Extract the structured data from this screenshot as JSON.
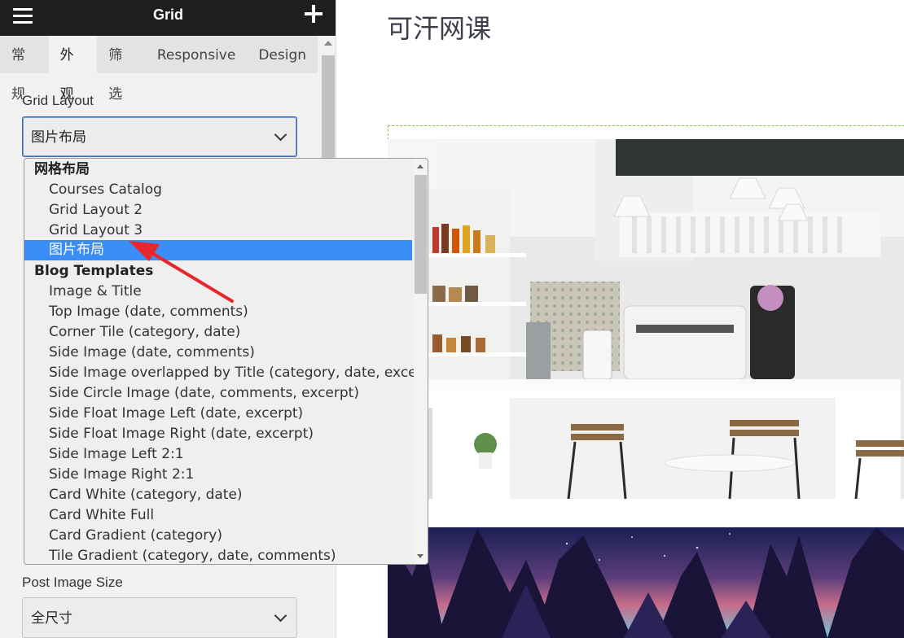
{
  "panel": {
    "title": "Grid",
    "tabs": [
      {
        "label": "常规"
      },
      {
        "label": "外观"
      },
      {
        "label": "筛选"
      },
      {
        "label": "Responsive"
      },
      {
        "label": "Design"
      }
    ],
    "active_tab": 1
  },
  "grid_layout": {
    "label": "Grid Layout",
    "value": "图片布局"
  },
  "dropdown": {
    "options": [
      {
        "label": "网格布局",
        "group": true
      },
      {
        "label": "Courses Catalog"
      },
      {
        "label": "Grid Layout 2"
      },
      {
        "label": "Grid Layout 3"
      },
      {
        "label": "图片布局",
        "selected": true
      },
      {
        "label": "Blog Templates",
        "group": true
      },
      {
        "label": "Image & Title"
      },
      {
        "label": "Top Image (date, comments)"
      },
      {
        "label": "Corner Tile (category, date)"
      },
      {
        "label": "Side Image (date, comments)"
      },
      {
        "label": "Side Image overlapped by Title (category, date, excerpt)"
      },
      {
        "label": "Side Circle Image (date, comments, excerpt)"
      },
      {
        "label": "Side Float Image Left (date, excerpt)"
      },
      {
        "label": "Side Float Image Right (date, excerpt)"
      },
      {
        "label": "Side Image Left 2:1"
      },
      {
        "label": "Side Image Right 2:1"
      },
      {
        "label": "Card White (category, date)"
      },
      {
        "label": "Card White Full"
      },
      {
        "label": "Card Gradient (category)"
      },
      {
        "label": "Tile Gradient (category, date, comments)"
      }
    ]
  },
  "post_image_size": {
    "label": "Post Image Size",
    "value": "全尺寸"
  },
  "site": {
    "title": "可汗网课"
  },
  "colors": {
    "selected_option": "#3a8df5",
    "annotation_arrow": "#e8262d",
    "topbar": "#1e1e1e"
  }
}
